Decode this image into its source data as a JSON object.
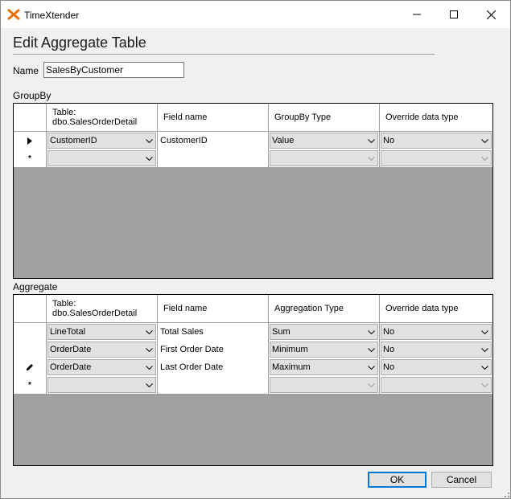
{
  "window": {
    "title": "TimeXtender"
  },
  "form": {
    "heading": "Edit Aggregate Table",
    "name_label": "Name",
    "name_value": "SalesByCustomer"
  },
  "groupby": {
    "label": "GroupBy",
    "columns": [
      "Table:",
      "dbo.SalesOrderDetail",
      "Field name",
      "GroupBy Type",
      "Override data type"
    ],
    "rows": [
      {
        "field": "CustomerID",
        "name": "CustomerID",
        "type": "Value",
        "override": "No"
      },
      {
        "field": "",
        "name": "",
        "type": "",
        "override": ""
      }
    ],
    "new_row_marker": "*"
  },
  "aggregate": {
    "label": "Aggregate",
    "columns": [
      "Table:",
      "dbo.SalesOrderDetail",
      "Field name",
      "Aggregation Type",
      "Override data type"
    ],
    "rows": [
      {
        "field": "LineTotal",
        "name": "Total Sales",
        "type": "Sum",
        "override": "No"
      },
      {
        "field": "OrderDate",
        "name": "First Order Date",
        "type": "Minimum",
        "override": "No"
      },
      {
        "field": "OrderDate",
        "name": "Last Order Date",
        "type": "Maximum",
        "override": "No"
      },
      {
        "field": "",
        "name": "",
        "type": "",
        "override": ""
      }
    ],
    "new_row_marker": "*"
  },
  "buttons": {
    "ok": "OK",
    "cancel": "Cancel"
  },
  "icons": {
    "logo": "timextender-x-logo",
    "row_indicator": "current-row-arrow-icon",
    "edit_indicator": "pencil-edit-icon",
    "new_row": "new-row-asterisk-icon",
    "dropdown": "chevron-down-icon"
  },
  "colors": {
    "accent": "#e8700a",
    "focus": "#0078d7",
    "grid_bg": "#a0a0a0"
  }
}
